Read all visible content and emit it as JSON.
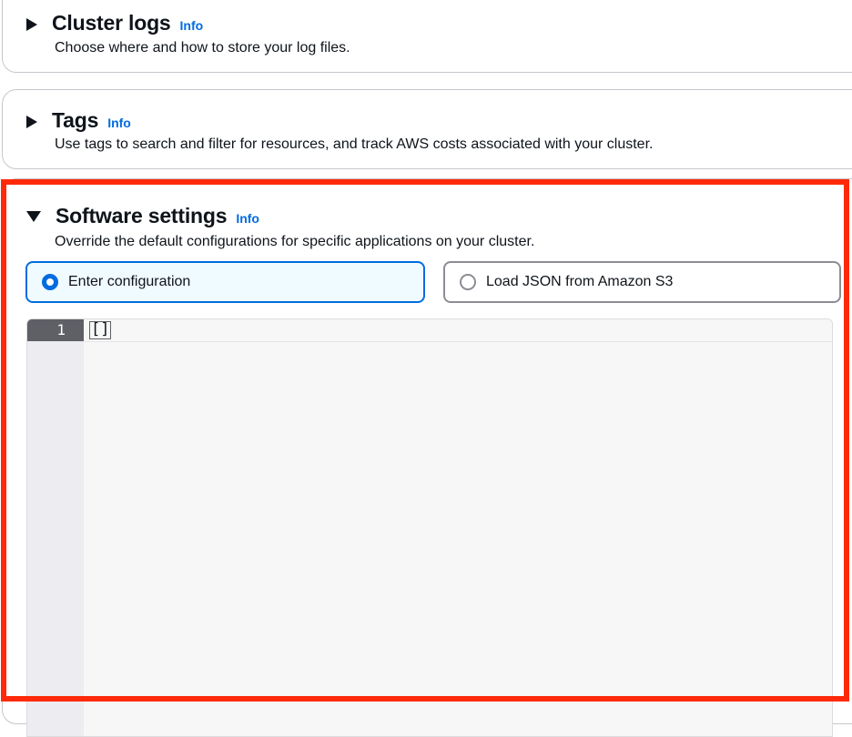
{
  "sections": {
    "cluster_logs": {
      "title": "Cluster logs",
      "info": "Info",
      "description": "Choose where and how to store your log files."
    },
    "tags": {
      "title": "Tags",
      "info": "Info",
      "description": "Use tags to search and filter for resources, and track AWS costs associated with your cluster."
    },
    "software_settings": {
      "title": "Software settings",
      "info": "Info",
      "description": "Override the default configurations for specific applications on your cluster.",
      "options": [
        {
          "label": "Enter configuration",
          "selected": true
        },
        {
          "label": "Load JSON from Amazon S3",
          "selected": false
        }
      ],
      "editor": {
        "line_numbers": [
          "1"
        ],
        "content": "[]"
      }
    }
  },
  "colors": {
    "accent": "#006ce0",
    "highlight": "#ff2a0a"
  }
}
